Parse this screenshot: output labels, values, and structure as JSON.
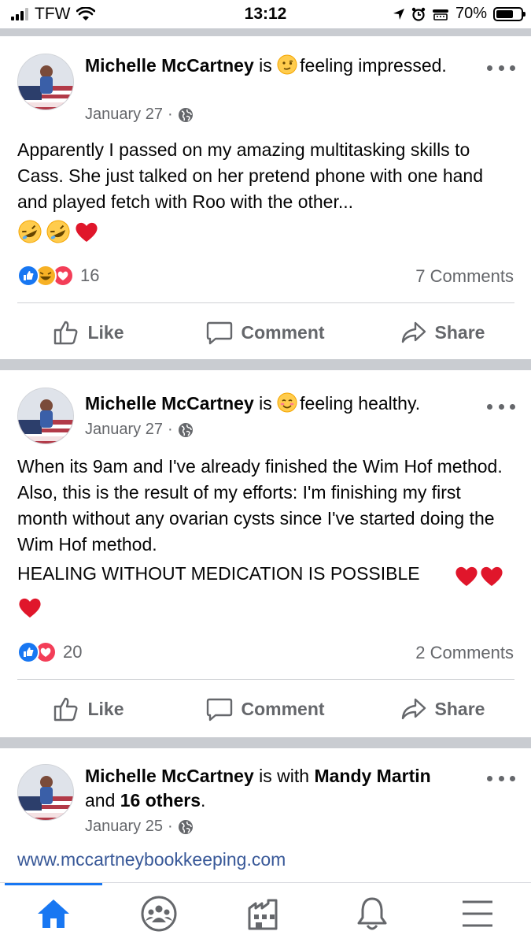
{
  "status_bar": {
    "carrier": "TFW",
    "time": "13:12",
    "battery": "70%",
    "battery_level": 0.7
  },
  "posts": [
    {
      "author": "Michelle McCartney",
      "connector": " is ",
      "feeling_prefix": "feeling",
      "feeling": " impressed.",
      "date": "January 27",
      "text": "Apparently I passed on my amazing multitasking skills to Cass.  She just talked on her pretend phone with one hand and played fetch with Roo with the other...",
      "reaction_count": "16",
      "comments": "7 Comments"
    },
    {
      "author": "Michelle McCartney",
      "connector": " is ",
      "feeling_prefix": "feeling",
      "feeling": " healthy.",
      "date": "January 27",
      "text": "When its 9am and I've already finished the Wim Hof method.   Also, this is the result of my efforts:  I'm finishing my first month without any ovarian cysts since I've started doing the Wim Hof method.",
      "text2": "HEALING WITHOUT MEDICATION IS POSSIBLE",
      "reaction_count": "20",
      "comments": "2 Comments"
    },
    {
      "author": "Michelle McCartney",
      "connector": " is with ",
      "tagged1": "Mandy Martin",
      "and": " and ",
      "tagged2": "16 others",
      "period": ".",
      "date": "January 25",
      "link": "www.mccartneybookkeeping.com"
    }
  ],
  "actions": {
    "like": "Like",
    "comment": "Comment",
    "share": "Share"
  },
  "colors": {
    "accent": "#1877f2",
    "heart": "#f33e58",
    "like_blue": "#1877f2",
    "link": "#385898"
  }
}
